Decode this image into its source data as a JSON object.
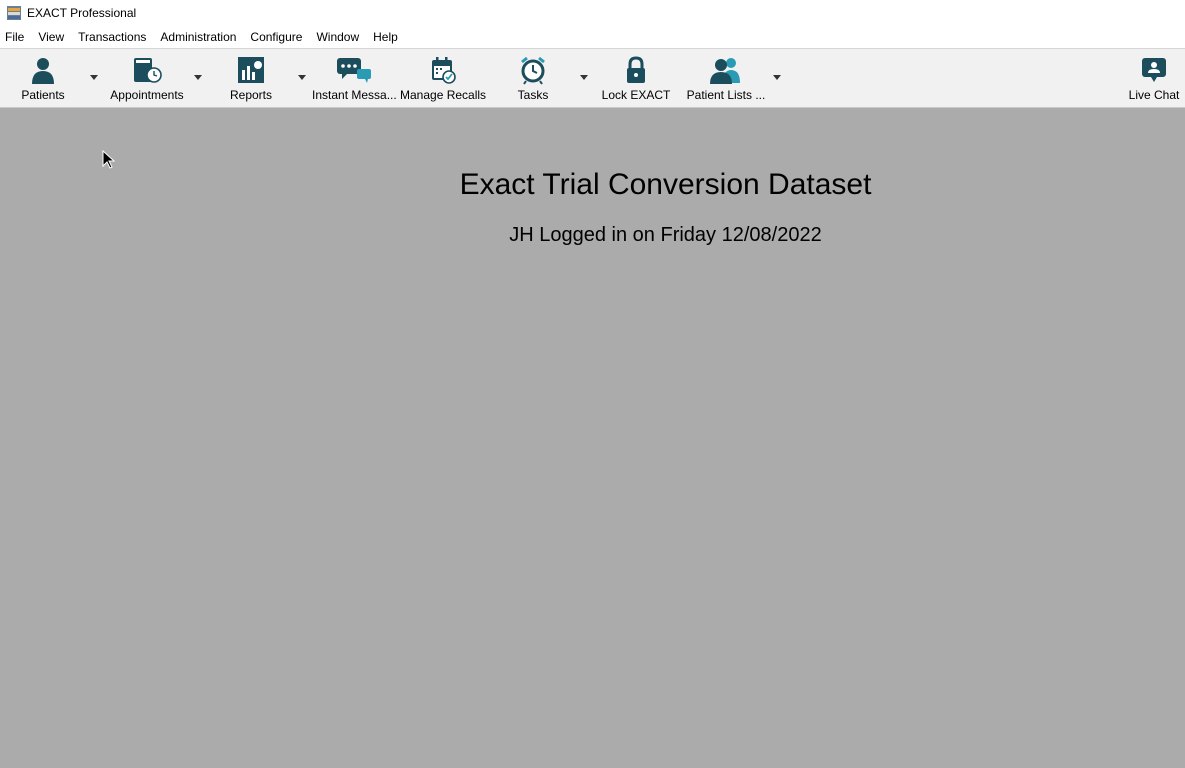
{
  "window": {
    "title": "EXACT Professional",
    "icon": "exact-app-icon"
  },
  "menu": [
    "File",
    "View",
    "Transactions",
    "Administration",
    "Configure",
    "Window",
    "Help"
  ],
  "toolbar": {
    "patients": "Patients",
    "appointments": "Appointments",
    "reports": "Reports",
    "instant_messages": "Instant Messa...",
    "manage_recalls": "Manage Recalls",
    "tasks": "Tasks",
    "lock": "Lock EXACT",
    "patient_lists": "Patient Lists ...",
    "live_chat": "Live Chat"
  },
  "workspace": {
    "title": "Exact Trial Conversion Dataset",
    "subtitle": "JH Logged in on Friday 12/08/2022"
  },
  "colors": {
    "icon": "#1b4d5c",
    "icon_accent": "#2a9bb5",
    "workspace_bg": "#ababab",
    "toolbar_bg": "#f1f1f1"
  }
}
